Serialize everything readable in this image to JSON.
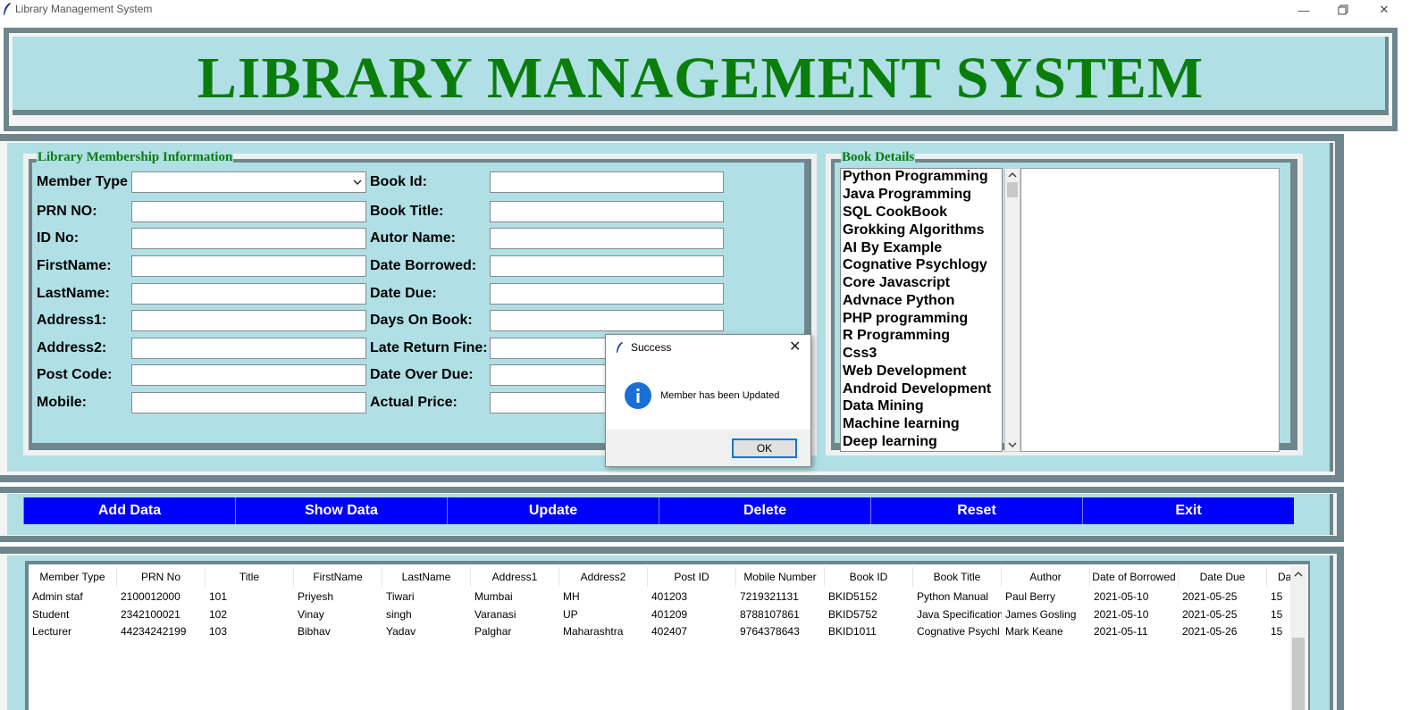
{
  "window": {
    "title": "Library Management System",
    "minimize_icon": "minimize-icon",
    "maximize_icon": "restore-icon",
    "close_icon": "close-icon"
  },
  "header": {
    "title": "LIBRARY MANAGEMENT SYSTEM",
    "title_color": "#0a7d0a"
  },
  "membership": {
    "legend": "Library Membership Information",
    "left_fields": [
      {
        "label": "Member Type",
        "value": "",
        "type": "combobox"
      },
      {
        "label": "PRN NO:",
        "value": ""
      },
      {
        "label": "ID No:",
        "value": ""
      },
      {
        "label": "FirstName:",
        "value": ""
      },
      {
        "label": "LastName:",
        "value": ""
      },
      {
        "label": "Address1:",
        "value": ""
      },
      {
        "label": "Address2:",
        "value": ""
      },
      {
        "label": "Post Code:",
        "value": ""
      },
      {
        "label": "Mobile:",
        "value": ""
      }
    ],
    "right_fields": [
      {
        "label": "Book Id:",
        "value": ""
      },
      {
        "label": "Book Title:",
        "value": ""
      },
      {
        "label": "Autor Name:",
        "value": ""
      },
      {
        "label": "Date Borrowed:",
        "value": ""
      },
      {
        "label": "Date Due:",
        "value": ""
      },
      {
        "label": "Days On Book:",
        "value": ""
      },
      {
        "label": "Late Return Fine:",
        "value": ""
      },
      {
        "label": "Date Over Due:",
        "value": ""
      },
      {
        "label": "Actual Price:",
        "value": ""
      }
    ]
  },
  "book_details": {
    "legend": "Book Details",
    "books": [
      "Python Programming",
      "Java Programming",
      "SQL CookBook",
      "Grokking Algorithms",
      "AI By Example",
      "Cognative Psychlogy",
      "Core Javascript",
      "Advnace Python",
      "PHP programming",
      "R Programming",
      "Css3",
      "Web Development",
      "Android Development",
      "Data Mining",
      "Machine learning",
      "Deep learning"
    ]
  },
  "buttons": {
    "add": "Add Data",
    "show": "Show Data",
    "update": "Update",
    "delete": "Delete",
    "reset": "Reset",
    "exit": "Exit",
    "color": "#0000ff"
  },
  "table": {
    "columns": [
      "Member Type",
      "PRN No",
      "Title",
      "FirstName",
      "LastName",
      "Address1",
      "Address2",
      "Post ID",
      "Mobile Number",
      "Book ID",
      "Book Title",
      "Author",
      "Date of Borrowed",
      "Date Due",
      "Da"
    ],
    "rows": [
      [
        "Admin staf",
        "2100012000",
        "101",
        "Priyesh",
        "Tiwari",
        "Mumbai",
        "MH",
        "401203",
        "7219321131",
        "BKID5152",
        "Python Manual",
        "Paul Berry",
        "2021-05-10",
        "2021-05-25",
        "15"
      ],
      [
        "Student",
        "2342100021",
        "102",
        "Vinay",
        "singh",
        "Varanasi",
        "UP",
        "401209",
        "8788107861",
        "BKID5752",
        "Java Specification",
        "James Gosling",
        "2021-05-10",
        "2021-05-25",
        "15"
      ],
      [
        "Lecturer",
        "44234242199",
        "103",
        "Bibhav",
        "Yadav",
        "Palghar",
        "Maharashtra",
        "402407",
        "9764378643",
        "BKID1011",
        "Cognative Psychl",
        "Mark Keane",
        "2021-05-11",
        "2021-05-26",
        "15"
      ]
    ]
  },
  "dialog": {
    "title": "Success",
    "message": "Member has been Updated",
    "ok": "OK",
    "icon": "info-icon"
  }
}
